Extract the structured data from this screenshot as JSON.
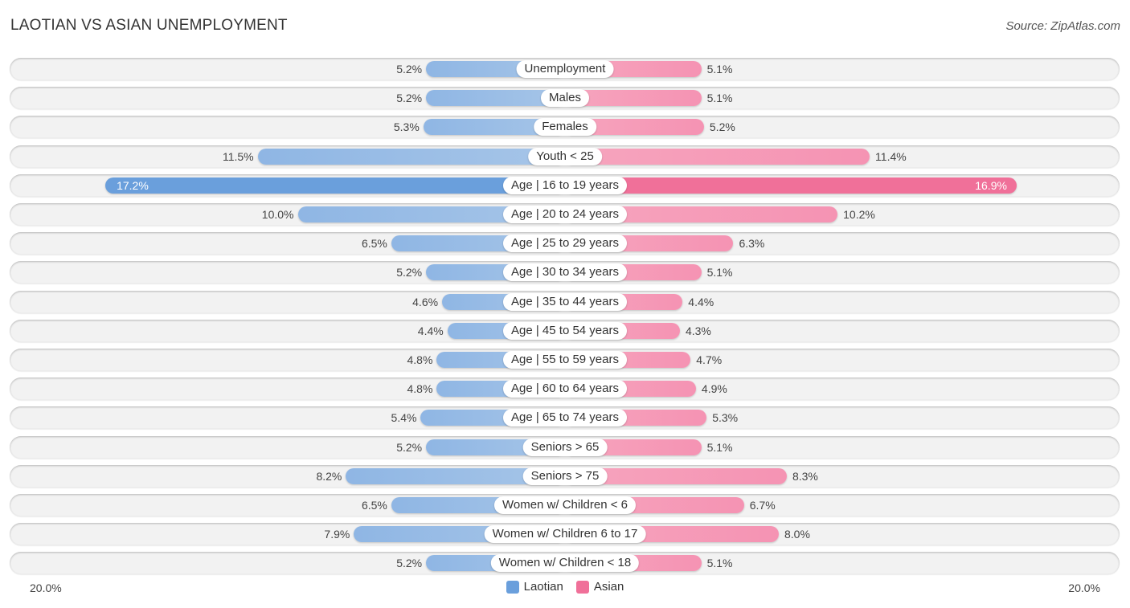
{
  "header": {
    "title": "LAOTIAN VS ASIAN UNEMPLOYMENT",
    "source": "Source: ZipAtlas.com"
  },
  "colors": {
    "laotian": "#a6c5e8",
    "laotian_strong": "#6a9fdc",
    "asian": "#f6a5be",
    "asian_strong": "#f07099"
  },
  "chart_data": {
    "type": "bar",
    "orientation": "horizontal-diverging",
    "title": "LAOTIAN VS ASIAN UNEMPLOYMENT",
    "categories": [
      "Unemployment",
      "Males",
      "Females",
      "Youth < 25",
      "Age | 16 to 19 years",
      "Age | 20 to 24 years",
      "Age | 25 to 29 years",
      "Age | 30 to 34 years",
      "Age | 35 to 44 years",
      "Age | 45 to 54 years",
      "Age | 55 to 59 years",
      "Age | 60 to 64 years",
      "Age | 65 to 74 years",
      "Seniors > 65",
      "Seniors > 75",
      "Women w/ Children < 6",
      "Women w/ Children 6 to 17",
      "Women w/ Children < 18"
    ],
    "series": [
      {
        "name": "Laotian",
        "side": "left",
        "values": [
          5.2,
          5.2,
          5.3,
          11.5,
          17.2,
          10.0,
          6.5,
          5.2,
          4.6,
          4.4,
          4.8,
          4.8,
          5.4,
          5.2,
          8.2,
          6.5,
          7.9,
          5.2
        ]
      },
      {
        "name": "Asian",
        "side": "right",
        "values": [
          5.1,
          5.1,
          5.2,
          11.4,
          16.9,
          10.2,
          6.3,
          5.1,
          4.4,
          4.3,
          4.7,
          4.9,
          5.3,
          5.1,
          8.3,
          6.7,
          8.0,
          5.1
        ]
      }
    ],
    "value_format": "{v}%",
    "xlim": [
      -20,
      20
    ],
    "axis_labels": {
      "left": "20.0%",
      "right": "20.0%"
    },
    "legend": {
      "position": "bottom-center",
      "entries": [
        "Laotian",
        "Asian"
      ]
    },
    "grid": false
  }
}
